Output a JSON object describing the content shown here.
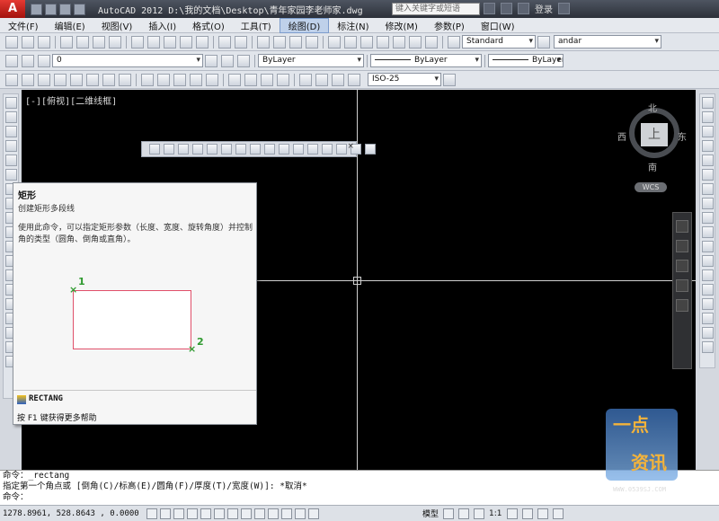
{
  "titlebar": {
    "app_logo": "A",
    "title": "AutoCAD 2012    D:\\我的文档\\Desktop\\青年家园李老师家.dwg",
    "search_placeholder": "键入关键字或短语",
    "login": "登录"
  },
  "menu": [
    "文件(F)",
    "编辑(E)",
    "视图(V)",
    "插入(I)",
    "格式(O)",
    "工具(T)",
    "绘图(D)",
    "标注(N)",
    "修改(M)",
    "参数(P)",
    "窗口(W)"
  ],
  "toolbar1": {
    "text_style": "Standard",
    "dim_style": "andar"
  },
  "toolbar2": {
    "layer": "0",
    "color": "ByLayer",
    "linetype": "ByLayer",
    "lineweight": "ByLayer"
  },
  "toolbar3": {
    "dim_scale": "ISO-25"
  },
  "canvas": {
    "viewport_label": "[-][俯视][二维线框]"
  },
  "viewcube": {
    "north": "北",
    "south": "南",
    "east": "东",
    "west": "西",
    "face": "上",
    "wcs": "WCS"
  },
  "tooltip": {
    "title": "矩形",
    "subtitle": "创建矩形多段线",
    "description": "使用此命令，可以指定矩形参数（长度、宽度、旋转角度）并控制角的类型（圆角、倒角或直角）。",
    "point1": "1",
    "point2": "2",
    "command": "RECTANG",
    "help": "按 F1 键获得更多帮助"
  },
  "cmdline": {
    "line1": "命令：_rectang",
    "line2": "指定第一个角点或 [倒角(C)/标高(E)/圆角(F)/厚度(T)/宽度(W)]: *取消*",
    "line3": "命令："
  },
  "status": {
    "coords": "1278.8961, 528.8643 , 0.0000",
    "model": "模型",
    "scale": "1:1"
  },
  "watermark": {
    "char1": "一点",
    "char2": "资讯",
    "url": "WWW.0539SJ.COM"
  }
}
